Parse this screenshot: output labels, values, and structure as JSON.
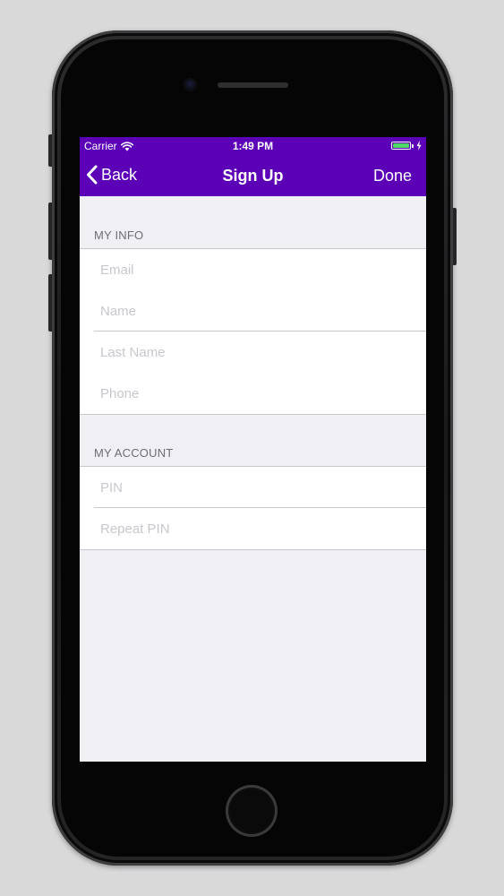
{
  "status_bar": {
    "carrier": "Carrier",
    "time": "1:49 PM",
    "battery_color": "#4cd964"
  },
  "nav": {
    "back_label": "Back",
    "title": "Sign Up",
    "done_label": "Done",
    "color": "#5c00b8"
  },
  "sections": [
    {
      "header": "MY INFO",
      "fields": [
        {
          "placeholder": "Email",
          "value": ""
        },
        {
          "placeholder": "Name",
          "value": ""
        },
        {
          "placeholder": "Last Name",
          "value": ""
        },
        {
          "placeholder": "Phone",
          "value": ""
        }
      ]
    },
    {
      "header": "MY ACCOUNT",
      "fields": [
        {
          "placeholder": "PIN",
          "value": ""
        },
        {
          "placeholder": "Repeat PIN",
          "value": ""
        }
      ]
    }
  ],
  "icons": {
    "wifi": "wifi-icon",
    "battery": "battery-icon",
    "charging": "charging-bolt-icon",
    "back": "chevron-left-icon"
  }
}
